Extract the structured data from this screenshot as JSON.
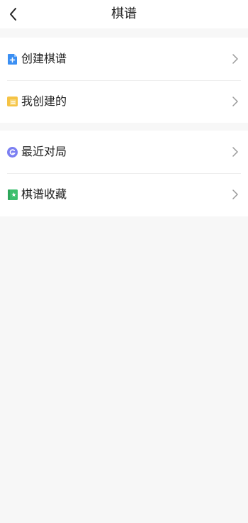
{
  "header": {
    "title": "棋谱"
  },
  "menu": {
    "group1": [
      {
        "label": "创建棋谱",
        "icon": "document-plus-icon",
        "color": "#3b8ff3"
      },
      {
        "label": "我创建的",
        "icon": "folder-icon",
        "color": "#f5c345"
      }
    ],
    "group2": [
      {
        "label": "最近对局",
        "icon": "recent-games-icon",
        "color": "#7b7ff2"
      },
      {
        "label": "棋谱收藏",
        "icon": "bookmark-star-icon",
        "color": "#3dbf6e"
      }
    ]
  }
}
